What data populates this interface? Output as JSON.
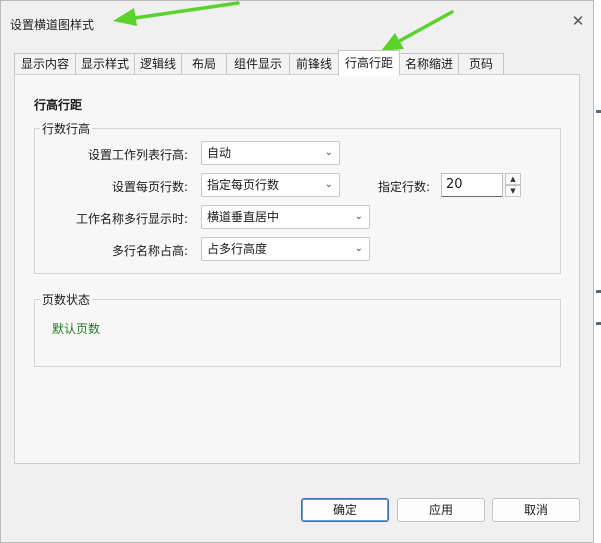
{
  "window": {
    "title": "设置横道图样式",
    "close_glyph": "✕"
  },
  "tabs": [
    {
      "label": "显示内容",
      "active": false
    },
    {
      "label": "显示样式",
      "active": false
    },
    {
      "label": "逻辑线",
      "active": false
    },
    {
      "label": "布局",
      "active": false
    },
    {
      "label": "组件显示",
      "active": false
    },
    {
      "label": "前锋线",
      "active": false
    },
    {
      "label": "行高行距",
      "active": true
    },
    {
      "label": "名称缩进",
      "active": false
    },
    {
      "label": "页码",
      "active": false
    }
  ],
  "section_title": "行高行距",
  "row_height_group": {
    "label": "行数行高",
    "fields": [
      {
        "label": "设置工作列表行高:",
        "value": "自动"
      },
      {
        "label": "设置每页行数:",
        "value": "指定每页行数"
      },
      {
        "label": "工作名称多行显示时:",
        "value": "横道垂直居中"
      },
      {
        "label": "多行名称占高:",
        "value": "占多行高度"
      }
    ],
    "rows_per_page": {
      "label": "指定行数:",
      "value": "20"
    }
  },
  "page_status_group": {
    "label": "页数状态",
    "text": "默认页数"
  },
  "buttons": {
    "ok": "确定",
    "apply": "应用",
    "cancel": "取消"
  },
  "colors": {
    "annotation_arrow": "#5bd22a",
    "status_text": "#1f7a1f",
    "primary_border": "#3b6ea8"
  }
}
